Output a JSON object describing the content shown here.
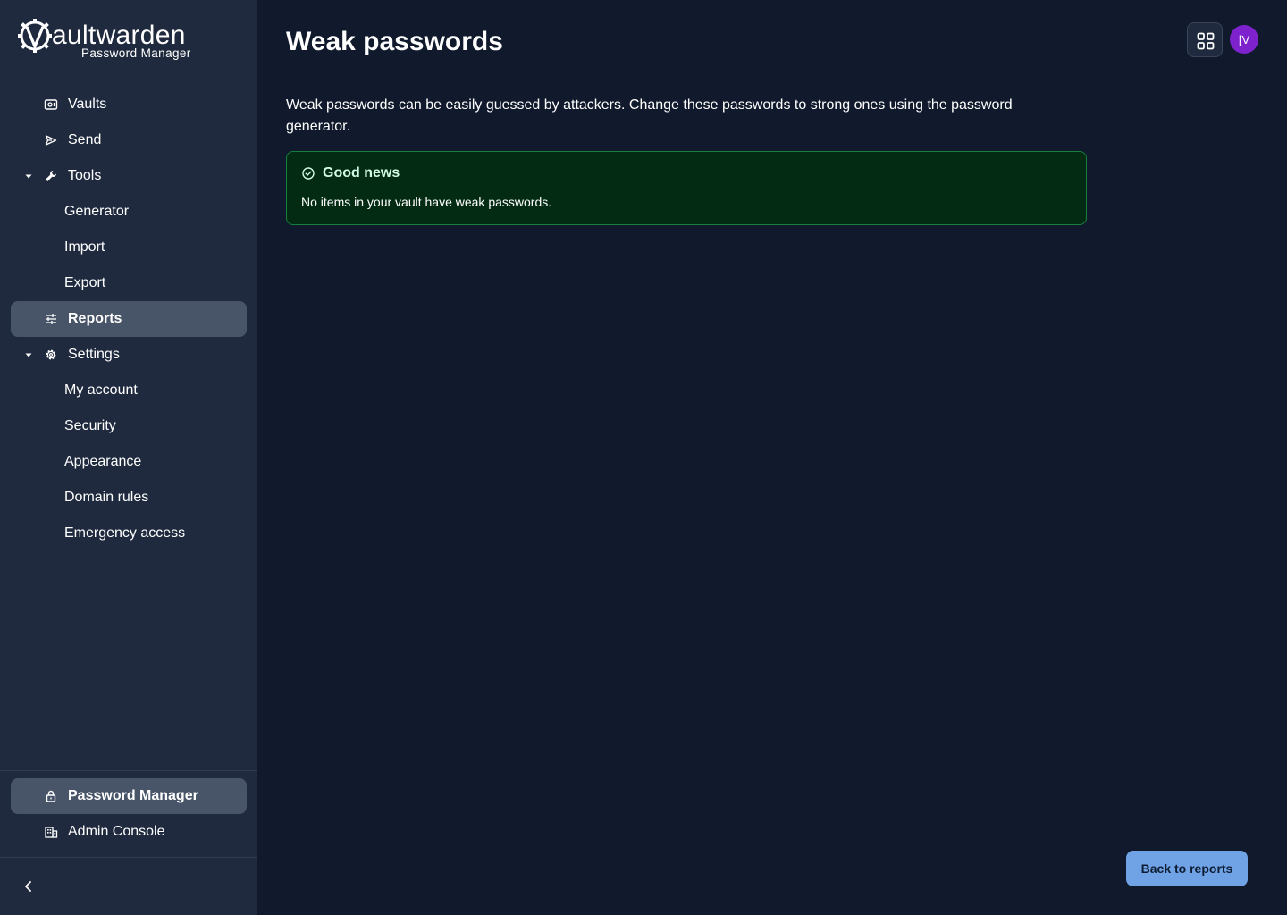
{
  "brand": {
    "wordmark": "aultwarden",
    "subtitle": "Password Manager"
  },
  "sidebar": {
    "items": [
      {
        "label": "Vaults",
        "icon": "vault-icon"
      },
      {
        "label": "Send",
        "icon": "send-icon"
      },
      {
        "label": "Tools",
        "icon": "wrench-icon",
        "expanded": true
      },
      {
        "label": "Generator"
      },
      {
        "label": "Import"
      },
      {
        "label": "Export"
      },
      {
        "label": "Reports",
        "icon": "sliders-icon",
        "active": true
      },
      {
        "label": "Settings",
        "icon": "gear-icon",
        "expanded": true
      },
      {
        "label": "My account"
      },
      {
        "label": "Security"
      },
      {
        "label": "Appearance"
      },
      {
        "label": "Domain rules"
      },
      {
        "label": "Emergency access"
      }
    ],
    "products": [
      {
        "label": "Password Manager",
        "icon": "lock-icon",
        "active": true
      },
      {
        "label": "Admin Console",
        "icon": "business-icon"
      }
    ],
    "collapse_icon": "chevron-left-icon"
  },
  "header": {
    "title": "Weak passwords",
    "apps_icon": "grid-icon",
    "avatar_initials": "[V"
  },
  "main": {
    "description": "Weak passwords can be easily guessed by attackers. Change these passwords to strong ones using the password generator.",
    "callout": {
      "title": "Good news",
      "text": "No items in your vault have weak passwords.",
      "icon": "check-circle-icon"
    },
    "back_button": "Back to reports"
  },
  "colors": {
    "background": "#111a2c",
    "sidebar": "#1f2a3e",
    "active_item": "#485468",
    "success_bg": "#032b13",
    "success_border": "#15803d",
    "avatar": "#7e22ce",
    "primary_button": "#6fa3e6"
  }
}
